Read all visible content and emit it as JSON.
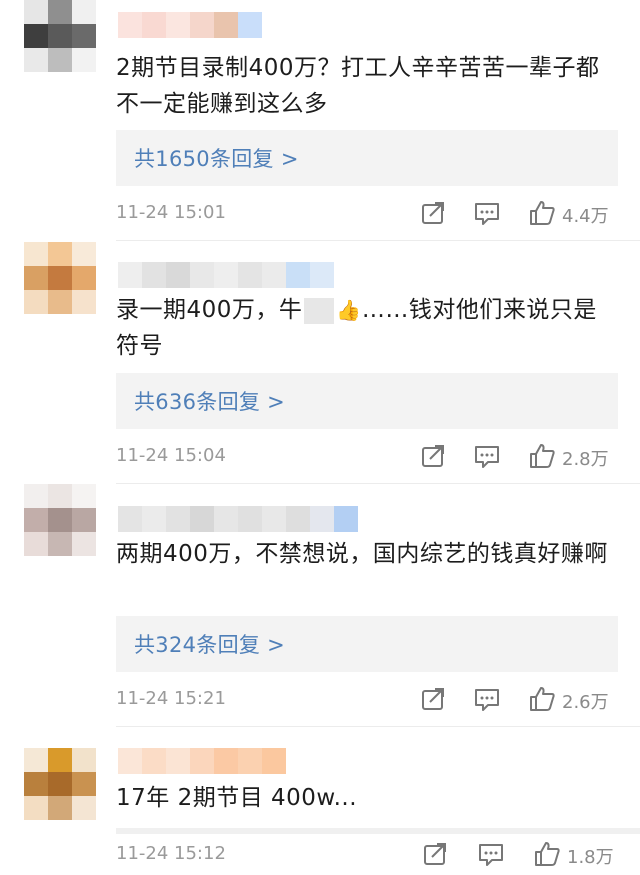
{
  "comments": [
    {
      "text": "2期节目录制400万？打工人辛辛苦苦一辈子都不一定能赚到这么多",
      "reply_label": "共1650条回复 >",
      "time": "11-24 15:01",
      "likes": "4.4万"
    },
    {
      "text_a": "录一期400万，牛",
      "emoji": "👍",
      "text_b": "……钱对他们来说只是符号",
      "reply_label": "共636条回复 >",
      "time": "11-24 15:04",
      "likes": "2.8万"
    },
    {
      "text": "两期400万，不禁想说，国内综艺的钱真好赚啊",
      "reply_label": "共324条回复 >",
      "time": "11-24 15:21",
      "likes": "2.6万"
    },
    {
      "text": "17年 2期节目 400w...",
      "time": "11-24 15:12",
      "likes": "1.8万"
    }
  ],
  "icons": {
    "share": "share-icon",
    "comment": "comment-icon",
    "like": "thumbs-up-icon"
  },
  "colors": {
    "link": "#4f7fb8",
    "meta": "#9a9a9a",
    "reply_bg": "#f3f3f3"
  }
}
